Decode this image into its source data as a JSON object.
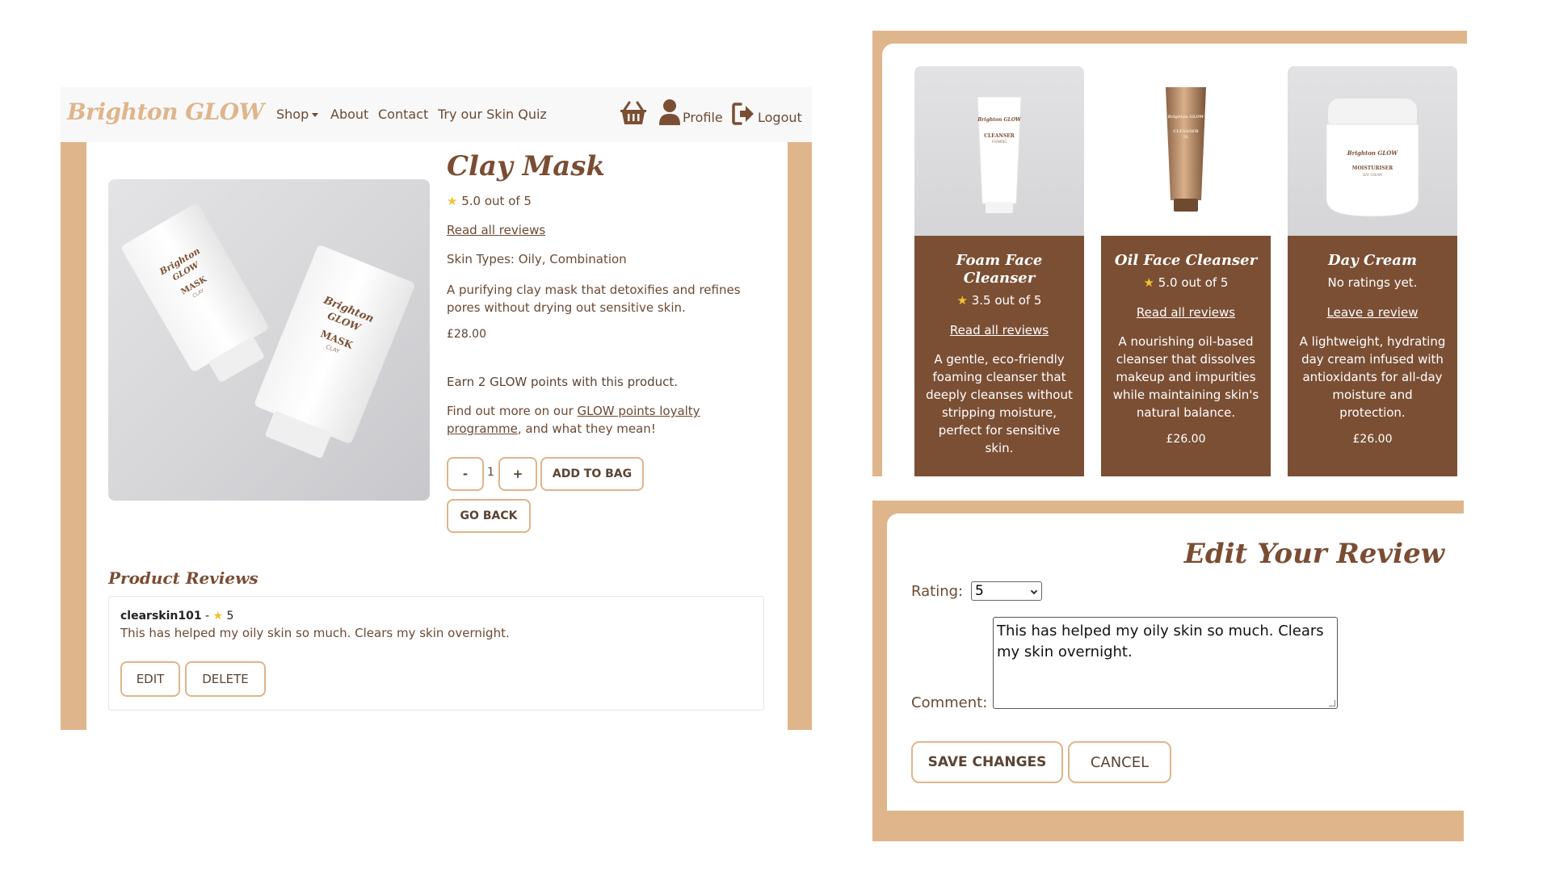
{
  "nav": {
    "logo": "Brighton GLOW",
    "shop": "Shop",
    "about": "About",
    "contact": "Contact",
    "quiz": "Try our Skin Quiz",
    "profile": "Profile",
    "logout": "Logout"
  },
  "product": {
    "title": "Clay Mask",
    "rating": "5.0 out of 5",
    "read_reviews": "Read all reviews",
    "skin_types": "Skin Types: Oily, Combination",
    "description": "A purifying clay mask that detoxifies and refines pores without drying out sensitive skin.",
    "price": "£28.00",
    "points": "Earn 2 GLOW points with this product.",
    "find_more_prefix": "Find out more on our ",
    "find_more_link": "GLOW points loyalty programme",
    "find_more_suffix": ", and what they mean!",
    "qty_minus": "-",
    "qty": "1",
    "qty_plus": "+",
    "add_to_bag": "ADD TO BAG",
    "go_back": "GO BACK",
    "image_labels": {
      "brand_line1": "Brighton",
      "brand_line2": "GLOW",
      "name": "MASK",
      "sub": "CLAY"
    }
  },
  "reviews": {
    "heading": "Product Reviews",
    "items": [
      {
        "user": "clearskin101",
        "rating": "5",
        "text": "This has helped my oily skin so much. Clears my skin overnight.",
        "edit": "EDIT",
        "delete": "DELETE"
      }
    ]
  },
  "products": [
    {
      "name": "Foam Face Cleanser",
      "rating": "3.5 out of 5",
      "link": "Read all reviews",
      "description": "A gentle, eco-friendly foaming cleanser that deeply cleanses without stripping moisture, perfect for sensitive skin.",
      "price": "£26.00",
      "image_labels": {
        "brand": "Brighton GLOW",
        "name": "CLEANSER",
        "sub": "FOAMING"
      }
    },
    {
      "name": "Oil Face Cleanser",
      "rating": "5.0 out of 5",
      "link": "Read all reviews",
      "description": "A nourishing oil-based cleanser that dissolves makeup and impurities while maintaining skin's natural balance.",
      "price": "£26.00",
      "image_labels": {
        "brand": "Brighton GLOW",
        "name": "CLEANSER",
        "sub": "OIL"
      }
    },
    {
      "name": "Day Cream",
      "rating": "No ratings yet.",
      "link": "Leave a review",
      "description": "A lightweight, hydrating day cream infused with antioxidants for all-day moisture and protection.",
      "price": "£26.00",
      "image_labels": {
        "brand": "Brighton GLOW",
        "name": "MOISTURISER",
        "sub": "DAY CREAM"
      }
    }
  ],
  "edit_review": {
    "title": "Edit Your Review",
    "rating_label": "Rating:",
    "rating_value": "5",
    "comment_label": "Comment:",
    "comment_value": "This has helped my oily skin so much. Clears my skin overnight.",
    "save": "SAVE CHANGES",
    "cancel": "CANCEL"
  },
  "colors": {
    "tan": "#dfb58b",
    "brown": "#7b4f34",
    "star": "#f2c230"
  }
}
